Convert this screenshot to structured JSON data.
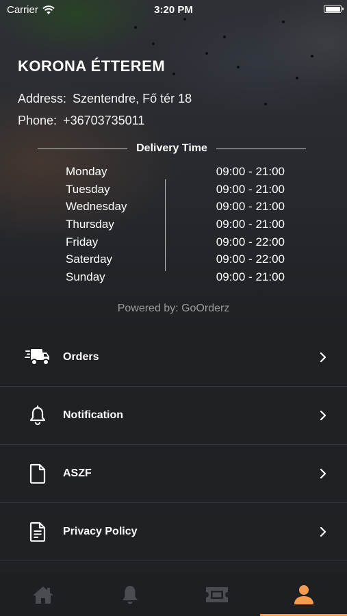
{
  "status_bar": {
    "carrier": "Carrier",
    "time": "3:20 PM"
  },
  "restaurant": {
    "name": "KORONA ÉTTEREM",
    "address_label": "Address:",
    "address_value": "Szentendre, Fő tér 18",
    "phone_label": "Phone:",
    "phone_value": "+36703735011"
  },
  "delivery": {
    "title": "Delivery Time",
    "hours": [
      {
        "day": "Monday",
        "time": "09:00 - 21:00"
      },
      {
        "day": "Tuesday",
        "time": "09:00 - 21:00"
      },
      {
        "day": "Wednesday",
        "time": "09:00 - 21:00"
      },
      {
        "day": "Thursday",
        "time": "09:00 - 21:00"
      },
      {
        "day": "Friday",
        "time": "09:00 - 22:00"
      },
      {
        "day": "Saterday",
        "time": "09:00 - 22:00"
      },
      {
        "day": "Sunday",
        "time": "09:00 - 21:00"
      }
    ]
  },
  "powered_by": "Powered by: GoOrderz",
  "menu": [
    {
      "label": "Orders",
      "icon": "delivery-truck-icon"
    },
    {
      "label": "Notification",
      "icon": "bell-icon"
    },
    {
      "label": "ASZF",
      "icon": "document-icon"
    },
    {
      "label": "Privacy Policy",
      "icon": "document-text-icon"
    }
  ],
  "tabbar": {
    "tabs": [
      {
        "icon": "home-icon",
        "active": false
      },
      {
        "icon": "bell-icon",
        "active": false
      },
      {
        "icon": "ticket-icon",
        "active": false
      },
      {
        "icon": "profile-icon",
        "active": true
      }
    ],
    "active_color": "#f39c4f",
    "inactive_color": "#4a4c52"
  }
}
